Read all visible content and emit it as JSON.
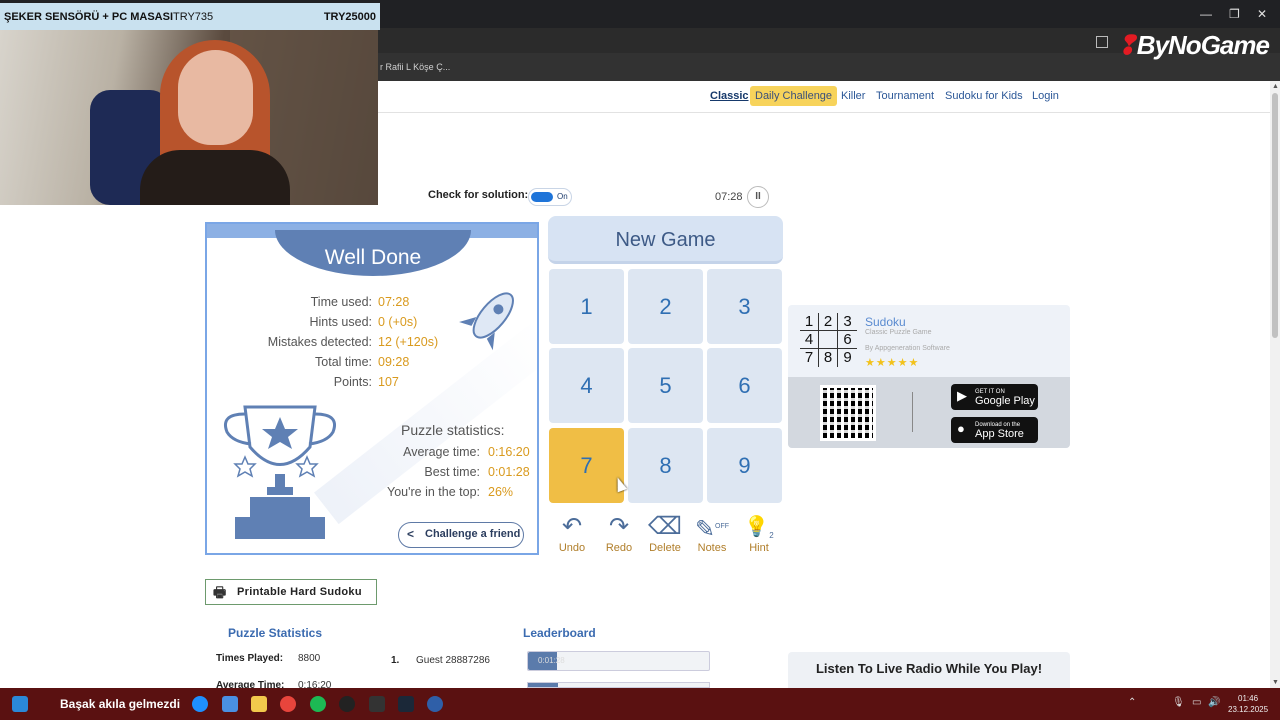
{
  "stream_overlay": {
    "title": "ŞEKER SENSÖRÜ + PC MASASI",
    "current": "TRY735",
    "goal": "TRY25000"
  },
  "browser": {
    "tab_title": "r Rafii L Köşe Ç...",
    "brand": "ByNoGame",
    "window_controls": [
      "—",
      "❐",
      "✕"
    ]
  },
  "nav": {
    "items": [
      {
        "label": "Classic",
        "state": "active"
      },
      {
        "label": "Daily Challenge",
        "state": "highlight"
      },
      {
        "label": "Killer"
      },
      {
        "label": "Tournament"
      },
      {
        "label": "Sudoku for Kids"
      },
      {
        "label": "Login"
      }
    ]
  },
  "controls": {
    "check_label": "Check for solution:",
    "toggle_state": "On",
    "timer": "07:28",
    "pause_icon": "pause-icon"
  },
  "result_card": {
    "title": "Well Done",
    "stats": [
      {
        "label": "Time used:",
        "value": "07:28"
      },
      {
        "label": "Hints used:",
        "value": "0 (+0s)"
      },
      {
        "label": "Mistakes detected:",
        "value": "12 (+120s)"
      },
      {
        "label": "Total time:",
        "value": "09:28"
      },
      {
        "label": "Points:",
        "value": "107"
      }
    ],
    "puzzle_stats_title": "Puzzle statistics:",
    "puzzle_stats": [
      {
        "label": "Average time:",
        "value": "0:16:20"
      },
      {
        "label": "Best time:",
        "value": "0:01:28"
      },
      {
        "label": "You're in the top:",
        "value": "26%"
      }
    ],
    "challenge_label": "Challenge a friend"
  },
  "game": {
    "new_game_label": "New Game",
    "numbers": [
      "1",
      "2",
      "3",
      "4",
      "5",
      "6",
      "7",
      "8",
      "9"
    ],
    "selected_number": "7",
    "tools": [
      {
        "label": "Undo",
        "icon": "undo-icon",
        "glyph": "↶"
      },
      {
        "label": "Redo",
        "icon": "redo-icon",
        "glyph": "↷"
      },
      {
        "label": "Delete",
        "icon": "eraser-icon",
        "glyph": "⌫"
      },
      {
        "label": "Notes",
        "icon": "pencil-icon",
        "glyph": "✎",
        "badge": "OFF"
      },
      {
        "label": "Hint",
        "icon": "lightbulb-icon",
        "glyph": "💡",
        "badge": "2"
      }
    ]
  },
  "app_ad": {
    "grid": [
      "1",
      "2",
      "3",
      "4",
      "",
      "6",
      "7",
      "8",
      "9"
    ],
    "name": "Sudoku",
    "subtitle": "Classic Puzzle Game",
    "publisher": "By Appgeneration Software",
    "stars": "★★★★★",
    "google_play": {
      "small": "GET IT ON",
      "label": "Google Play"
    },
    "app_store": {
      "small": "Download on the",
      "label": "App Store"
    }
  },
  "bottom": {
    "printable_label": "Printable Hard Sudoku",
    "puzzle_statistics_title": "Puzzle Statistics",
    "times_played_label": "Times Played:",
    "times_played_value": "8800",
    "average_time_label": "Average Time:",
    "average_time_value": "0:16:20",
    "leaderboard_title": "Leaderboard",
    "leaderboard": [
      {
        "rank": "1.",
        "name": "Guest 28887286",
        "time": "0:01:28",
        "fill": 0.16
      }
    ],
    "radio_label": "Listen To Live Radio While You Play!"
  },
  "taskbar": {
    "ticker": "Başak akıla gelmezdi",
    "time": "01:46",
    "date": "23.12.2025"
  },
  "colors": {
    "accent_blue": "#5f80b4",
    "highlight_yellow": "#f0be45",
    "value_orange": "#d99a1e",
    "link_blue": "#2b5797"
  }
}
